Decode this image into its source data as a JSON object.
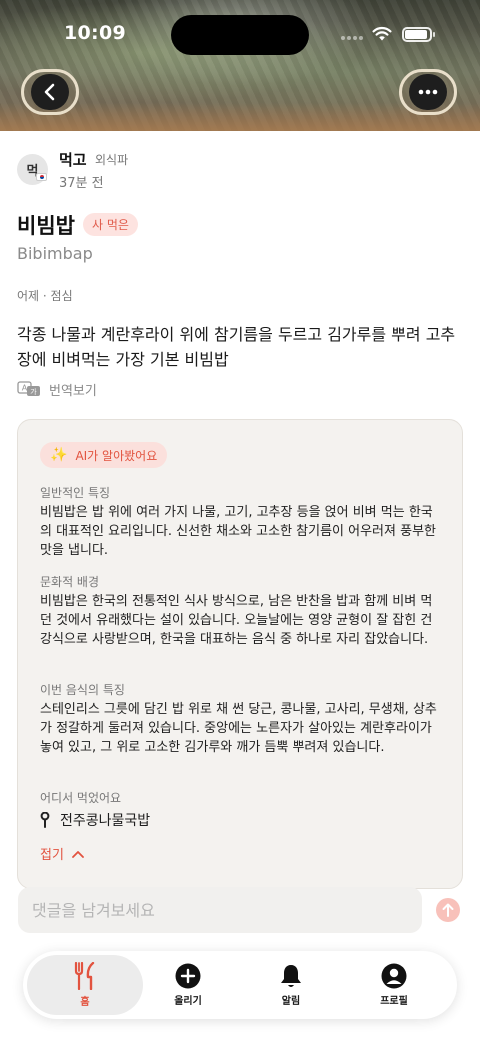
{
  "status_bar": {
    "time": "10:09"
  },
  "post": {
    "author": {
      "avatar_text": "먹",
      "name": "먹고",
      "tag": "외식파",
      "time_ago": "37분 전"
    },
    "dish_name": "비빔밥",
    "badge": "사 먹은",
    "dish_name_en": "Bibimbap",
    "meal_time": "어제 · 점심",
    "description": "각종 나물과 계란후라이 위에 참기름을 두르고 김가루를 뿌려 고추장에 비벼먹는 가장 기본 비빔밥",
    "translate_label": "번역보기"
  },
  "ai": {
    "badge_label": "AI가 알아봤어요",
    "sections": [
      {
        "heading": "일반적인 특징",
        "body": "비빔밥은 밥 위에 여러 가지 나물, 고기, 고추장 등을 얹어 비벼 먹는 한국의 대표적인 요리입니다. 신선한 채소와 고소한 참기름이 어우러져 풍부한 맛을 냅니다."
      },
      {
        "heading": "문화적 배경",
        "body": "비빔밥은 한국의 전통적인 식사 방식으로, 남은 반찬을 밥과 함께 비벼 먹던 것에서 유래했다는 설이 있습니다. 오늘날에는 영양 균형이 잘 잡힌 건강식으로 사랑받으며, 한국을 대표하는 음식 중 하나로 자리 잡았습니다."
      },
      {
        "heading": "이번 음식의 특징",
        "body": "스테인리스 그릇에 담긴 밥 위로 채 썬 당근, 콩나물, 고사리, 무생채, 상추가 정갈하게 둘러져 있습니다. 중앙에는 노른자가 살아있는 계란후라이가 놓여 있고, 그 위로 고소한 김가루와 깨가 듬뿍 뿌려져 있습니다."
      }
    ],
    "place_heading": "어디서 먹었어요",
    "place_name": "전주콩나물국밥",
    "fold_label": "접기"
  },
  "comment": {
    "placeholder": "댓글을 남겨보세요"
  },
  "tabs": [
    {
      "label": "홈",
      "icon": "fork-knife-icon",
      "active": true
    },
    {
      "label": "올리기",
      "icon": "plus-circle-icon",
      "active": false
    },
    {
      "label": "알림",
      "icon": "bell-icon",
      "active": false
    },
    {
      "label": "프로필",
      "icon": "person-icon",
      "active": false
    }
  ],
  "colors": {
    "accent": "#e2533f",
    "badge_bg": "#fde3e0",
    "card_bg": "#f4f2ef",
    "send_button": "#f8c1ba"
  }
}
